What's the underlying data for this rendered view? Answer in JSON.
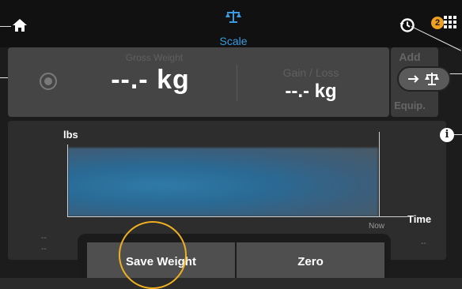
{
  "header": {
    "title": "Scale",
    "notification_count": "2",
    "icons": {
      "home": "home-icon",
      "scale": "scale-icon",
      "history": "history-icon",
      "apps": "grid-icon"
    }
  },
  "weight": {
    "gross_label": "Gross Weight",
    "gross_value": "--.- kg",
    "gain_label": "Gain / Loss",
    "gain_value": "--.- kg"
  },
  "equipment": {
    "add_label": "Add",
    "equip_label": "Equip."
  },
  "graph": {
    "y_label": "lbs",
    "x_label": "Time",
    "now_label": "Now",
    "left_values": [
      "--",
      "--"
    ],
    "right_value": "--"
  },
  "buttons": {
    "save_label": "Save Weight",
    "zero_label": "Zero"
  },
  "colors": {
    "accent": "#3a9be0",
    "badge": "#f0a020",
    "highlight": "#f0b020",
    "graph_fill": "#2f7aa8"
  }
}
